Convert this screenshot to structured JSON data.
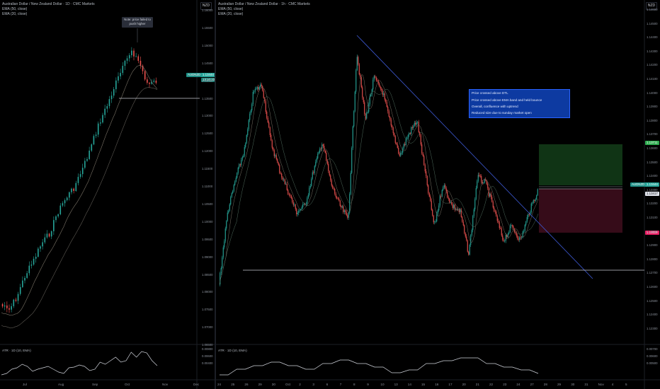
{
  "left_chart": {
    "title": "Australian Dollar / New Zealand Dollar · 1D · CMC Markets",
    "ema1": "EMA (50, close)",
    "ema2": "EMA (20, close)",
    "currency": "NZD",
    "note": "Note: price failed to push higher",
    "symbol_tag": "AUDNZD",
    "price_tag": "1.13444",
    "price_tag2": "13:10:23",
    "y_ticks": [
      "1.16000",
      "1.15500",
      "1.15000",
      "1.14500",
      "1.14000",
      "1.13500",
      "1.13000",
      "1.12500",
      "1.12000",
      "1.11500",
      "1.11000",
      "1.10500",
      "1.10000",
      "1.09500",
      "1.09000",
      "1.08500",
      "1.08000",
      "1.07500",
      "1.07000",
      "1.06500"
    ],
    "x_ticks": [
      "Jul",
      "Aug",
      "Sep",
      "Oct",
      "Nov",
      "Dec"
    ],
    "indicator": {
      "title": "ATR · 1D (10, EMA)",
      "y_ticks": [
        "0.00800",
        "0.00600",
        "0.00400"
      ]
    }
  },
  "right_chart": {
    "title": "Australian Dollar / New Zealand Dollar · 1h · CMC Markets",
    "ema1": "EMA (50, close)",
    "ema2": "EMA (20, close)",
    "currency": "NZD",
    "info_lines": [
      "Price crossed above DTL",
      "Price crossed above EMA band and held bounce",
      "Overall, confluence with uptrend",
      "Reduced size due to sunday market open"
    ],
    "target_tag": "1.13711",
    "symbol_tag": "AUDNZD",
    "price_tag": "1.13444",
    "entry_tag": "1.13417",
    "stop_tag": "1.13118",
    "y_ticks": [
      "1.14600",
      "1.14500",
      "1.14400",
      "1.14300",
      "1.14200",
      "1.14100",
      "1.14000",
      "1.13900",
      "1.13800",
      "1.13700",
      "1.13600",
      "1.13500",
      "1.13400",
      "1.13300",
      "1.13200",
      "1.13100",
      "1.13000",
      "1.12900",
      "1.12800",
      "1.12700",
      "1.12600",
      "1.12500",
      "1.12400",
      "1.12300"
    ],
    "x_ticks": [
      "24",
      "25",
      "26",
      "29",
      "30",
      "Oct",
      "2",
      "3",
      "6",
      "7",
      "8",
      "9",
      "10",
      "13",
      "14",
      "15",
      "16",
      "17",
      "20",
      "21",
      "22",
      "23",
      "24",
      "27",
      "28",
      "29",
      "30",
      "31",
      "Nov",
      "4",
      "5"
    ],
    "indicator": {
      "title": "ATR · 1D (10, EMA)",
      "y_ticks": [
        "0.00700",
        "0.00600",
        "0.00500"
      ]
    }
  },
  "colors": {
    "up": "#26a69a",
    "down": "#ef5350",
    "trendline": "#3d5ad6",
    "support": "#c7c9cf",
    "target_zone": "#123a17",
    "stop_zone": "#3c0d1c",
    "target_tag": "#2eaa4f",
    "stop_tag": "#e91e63",
    "price_tag": "#26a69a"
  }
}
